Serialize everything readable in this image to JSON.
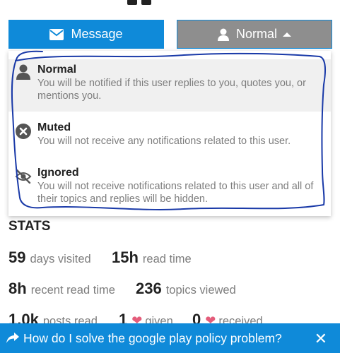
{
  "buttons": {
    "message_label": "Message",
    "notification_label": "Normal"
  },
  "notification_menu": {
    "options": [
      {
        "title": "Normal",
        "description": "You will be notified if this user replies to you, quotes you, or mentions you.",
        "icon": "user-icon",
        "selected": true
      },
      {
        "title": "Muted",
        "description": "You will not receive any notifications related to this user.",
        "icon": "times-circle-icon",
        "selected": false
      },
      {
        "title": "Ignored",
        "description": "You will not receive notifications related to this user and all of their topics and replies will be hidden.",
        "icon": "eye-slash-icon",
        "selected": false
      }
    ]
  },
  "stats": {
    "heading": "STATS",
    "items": [
      {
        "value": "59",
        "label": "days visited"
      },
      {
        "value": "15h",
        "label": "read time"
      },
      {
        "value": "8h",
        "label": "recent read time"
      },
      {
        "value": "236",
        "label": "topics viewed"
      },
      {
        "value": "1.0k",
        "label": "posts read"
      },
      {
        "value": "1",
        "label": "given"
      },
      {
        "value": "0",
        "label": "received"
      }
    ]
  },
  "banner": {
    "text": "How do I solve the google play policy problem?",
    "close_glyph": "✕"
  },
  "colors": {
    "primary": "#0f8ad9",
    "button_gray": "#8e8e8e",
    "heart": "#e45c7a",
    "scribble": "#1a3aa8"
  }
}
